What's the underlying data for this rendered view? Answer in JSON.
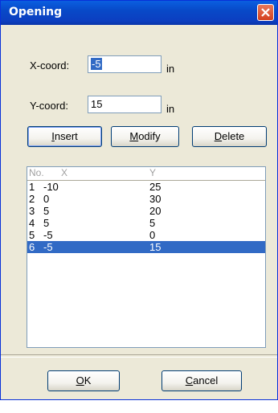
{
  "dialog": {
    "title": "Opening"
  },
  "form": {
    "x_label": "X-coord:",
    "x_value": "-5",
    "x_unit": "in",
    "y_label": "Y-coord:",
    "y_value": "15",
    "y_unit": "in"
  },
  "buttons": {
    "insert_u": "I",
    "insert_rest": "nsert",
    "modify_u": "M",
    "modify_rest": "odify",
    "delete_u": "D",
    "delete_rest": "elete",
    "ok_u": "O",
    "ok_rest": "K",
    "cancel_u": "C",
    "cancel_rest": "ancel"
  },
  "list": {
    "headers": {
      "no": "No.",
      "x": "X",
      "y": "Y"
    },
    "rows": [
      {
        "no": "1",
        "x": "-10",
        "y": "25"
      },
      {
        "no": "2",
        "x": "0",
        "y": "30"
      },
      {
        "no": "3",
        "x": "5",
        "y": "20"
      },
      {
        "no": "4",
        "x": "5",
        "y": "5"
      },
      {
        "no": "5",
        "x": "-5",
        "y": "0"
      },
      {
        "no": "6",
        "x": "-5",
        "y": "15"
      }
    ],
    "selected_row": 6
  },
  "icons": {
    "close": "close-icon"
  }
}
